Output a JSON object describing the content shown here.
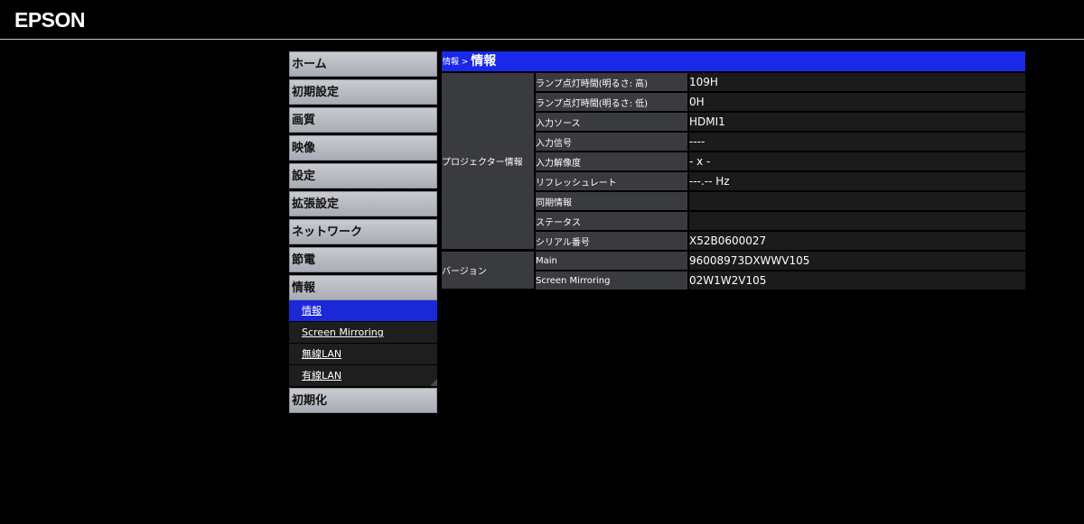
{
  "brand": {
    "logo": "EPSON"
  },
  "sidebar": {
    "items": [
      {
        "label": "ホーム"
      },
      {
        "label": "初期設定"
      },
      {
        "label": "画質"
      },
      {
        "label": "映像"
      },
      {
        "label": "設定"
      },
      {
        "label": "拡張設定"
      },
      {
        "label": "ネットワーク"
      },
      {
        "label": "節電"
      },
      {
        "label": "情報"
      },
      {
        "label": "初期化"
      }
    ],
    "submenu": [
      {
        "label": "情報",
        "active": true
      },
      {
        "label": "Screen Mirroring",
        "active": false
      },
      {
        "label": "無線LAN",
        "active": false
      },
      {
        "label": "有線LAN",
        "active": false
      }
    ]
  },
  "main": {
    "breadcrumb": "情報",
    "breadcrumb_sep": " > ",
    "title": "情報",
    "groups": {
      "projector": "プロジェクター情報",
      "version": "バージョン"
    },
    "rows": [
      {
        "label": "ランプ点灯時間(明るさ: 高)",
        "value": "109H"
      },
      {
        "label": "ランプ点灯時間(明るさ: 低)",
        "value": "0H"
      },
      {
        "label": "入力ソース",
        "value": "HDMI1"
      },
      {
        "label": "入力信号",
        "value": "----"
      },
      {
        "label": "入力解像度",
        "value": "- x -"
      },
      {
        "label": "リフレッシュレート",
        "value": "---.-- Hz"
      },
      {
        "label": "同期情報",
        "value": ""
      },
      {
        "label": "ステータス",
        "value": ""
      },
      {
        "label": "シリアル番号",
        "value": "X52B0600027"
      },
      {
        "label": "Main",
        "value": "96008973DXWWV105"
      },
      {
        "label": "Screen Mirroring",
        "value": "02W1W2V105"
      }
    ]
  },
  "colors": {
    "accent_blue": "#1a28e8",
    "menu_gray": "#b9bcc3",
    "row_label_bg": "#3a3b3e",
    "row_value_bg": "#1b1b1b"
  }
}
